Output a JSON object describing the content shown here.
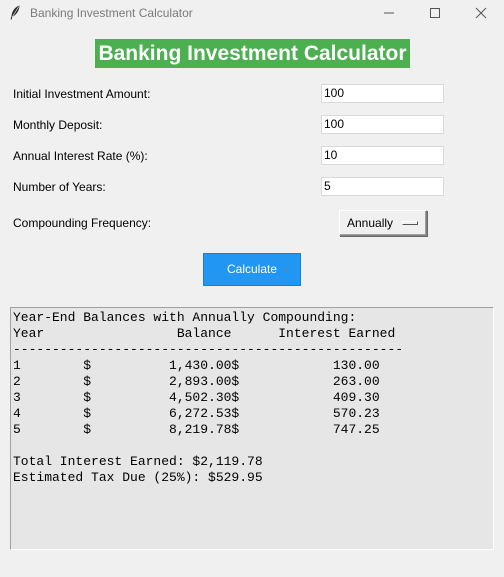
{
  "window": {
    "title": "Banking Investment Calculator",
    "icon": "feather-icon"
  },
  "header": {
    "title": "Banking Investment Calculator",
    "bg_color": "#4caf50"
  },
  "form": {
    "initial_label": "Initial Investment Amount:",
    "initial_value": "100",
    "monthly_label": "Monthly Deposit:",
    "monthly_value": "100",
    "rate_label": "Annual Interest Rate (%):",
    "rate_value": "10",
    "years_label": "Number of Years:",
    "years_value": "5",
    "compounding_label": "Compounding Frequency:",
    "compounding_value": "Annually"
  },
  "calculate_button": {
    "label": "Calculate",
    "color": "#2196f3"
  },
  "output": {
    "text": "Year-End Balances with Annually Compounding:\nYear                 Balance      Interest Earned\n--------------------------------------------------\n1        $          1,430.00$            130.00\n2        $          2,893.00$            263.00\n3        $          4,502.30$            409.30\n4        $          6,272.53$            570.23\n5        $          8,219.78$            747.25\n\nTotal Interest Earned: $2,119.78\nEstimated Tax Due (25%): $529.95"
  }
}
